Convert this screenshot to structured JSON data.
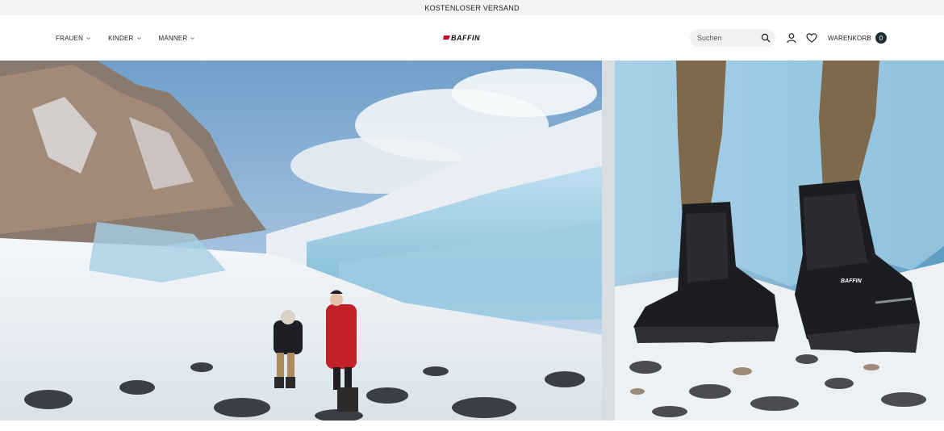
{
  "announcement": {
    "text": "KOSTENLOSER VERSAND"
  },
  "nav": {
    "items": [
      {
        "label": "FRAUEN"
      },
      {
        "label": "KINDER"
      },
      {
        "label": "MÄNNER"
      }
    ]
  },
  "brand": {
    "name": "BAFFIN",
    "accent": "#c8102e"
  },
  "search": {
    "placeholder": "Suchen",
    "value": ""
  },
  "icons": {
    "search": "search-icon",
    "account": "user-icon",
    "wishlist": "heart-icon"
  },
  "cart": {
    "label": "WARENKORB",
    "count": "0",
    "badge_color": "#1f2e33"
  },
  "hero": {
    "left_image": "two-hikers-on-glacier",
    "right_image": "baffin-boots-closeup",
    "boot_brand": "BAFFIN"
  }
}
